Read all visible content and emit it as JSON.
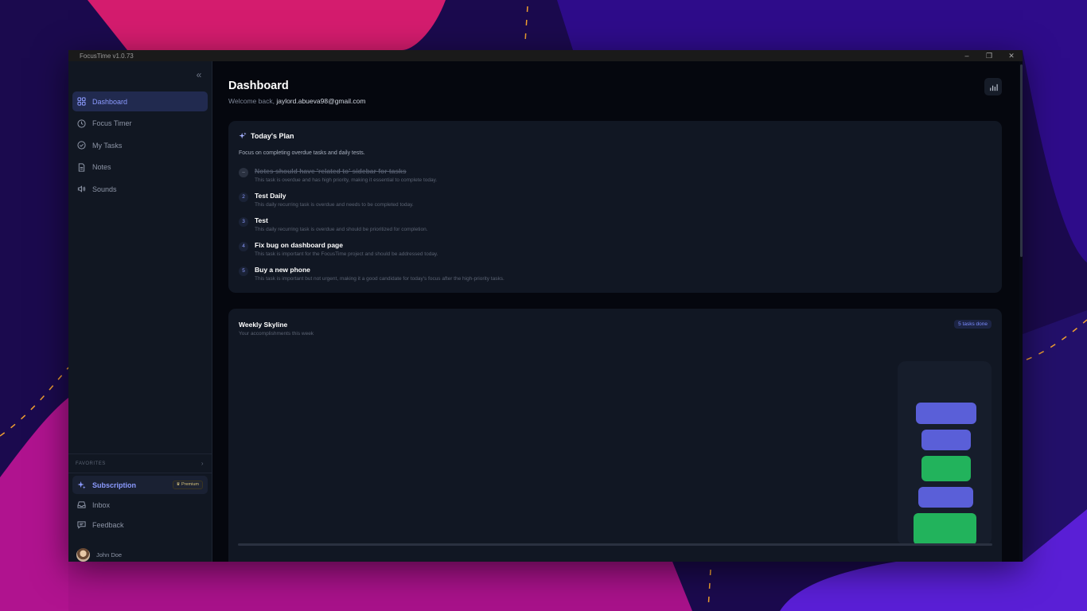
{
  "window": {
    "title": "FocusTime v1.0.73",
    "controls": {
      "minimize": "–",
      "restore": "❐",
      "close": "✕"
    }
  },
  "sidebar": {
    "collapse_icon": "chevrons-left-icon",
    "items": [
      {
        "label": "Dashboard",
        "icon": "grid-icon",
        "active": true
      },
      {
        "label": "Focus Timer",
        "icon": "clock-icon",
        "active": false
      },
      {
        "label": "My Tasks",
        "icon": "check-circle-icon",
        "active": false
      },
      {
        "label": "Notes",
        "icon": "file-icon",
        "active": false
      },
      {
        "label": "Sounds",
        "icon": "speaker-icon",
        "active": false
      }
    ],
    "favorites_label": "FAVORITES",
    "bottom": [
      {
        "label": "Subscription",
        "icon": "sparkles-icon",
        "badge": "Premium"
      },
      {
        "label": "Inbox",
        "icon": "inbox-icon"
      },
      {
        "label": "Feedback",
        "icon": "message-icon"
      }
    ],
    "user": {
      "name": "John Doe"
    }
  },
  "header": {
    "title": "Dashboard",
    "welcome_prefix": "Welcome back,",
    "email": "jaylord.abueva98@gmail.com"
  },
  "plan": {
    "title": "Today's Plan",
    "description": "Focus on completing overdue tasks and daily tests.",
    "tasks": [
      {
        "num": "–",
        "title": "Notes should have 'related to' sidebar for tasks",
        "desc": "This task is overdue and has high priority, making it essential to complete today.",
        "done": true
      },
      {
        "num": "2",
        "title": "Test Daily",
        "desc": "This daily recurring task is overdue and needs to be completed today.",
        "done": false
      },
      {
        "num": "3",
        "title": "Test",
        "desc": "This daily recurring task is overdue and should be prioritized for completion.",
        "done": false
      },
      {
        "num": "4",
        "title": "Fix bug on dashboard page",
        "desc": "This task is important for the FocusTime project and should be addressed today.",
        "done": false
      },
      {
        "num": "5",
        "title": "Buy a new phone",
        "desc": "This task is important but not urgent, making it a good candidate for today's focus after the high-priority tasks.",
        "done": false
      }
    ]
  },
  "skyline": {
    "title": "Weekly Skyline",
    "subtitle": "Your accomplishments this week",
    "badge": "5 tasks done",
    "colors": {
      "purple": "#5a5fd8",
      "green": "#22b35c"
    }
  }
}
